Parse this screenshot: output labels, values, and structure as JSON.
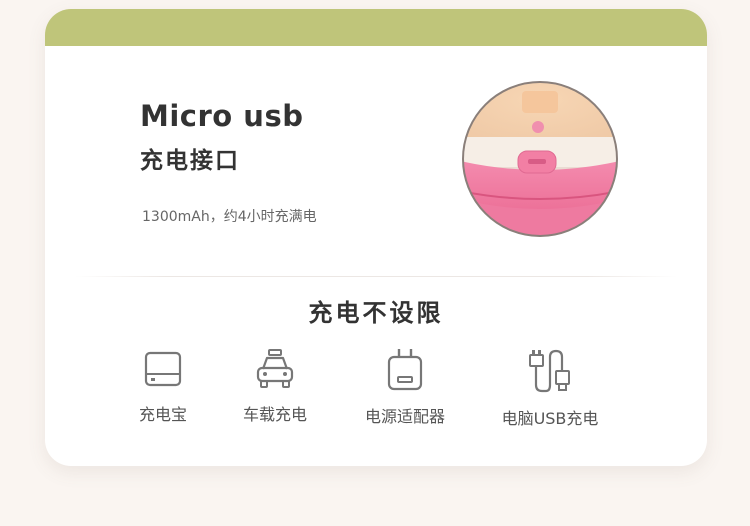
{
  "feature": {
    "title_en": "Micro usb",
    "title_cn": "充电接口",
    "description": "1300mAh，约4小时充满电",
    "product_image": "pink-humidifier-micro-usb-port"
  },
  "charging": {
    "section_title": "充电不设限",
    "options": [
      {
        "label": "充电宝",
        "icon": "power-bank-icon"
      },
      {
        "label": "车载充电",
        "icon": "car-icon"
      },
      {
        "label": "电源适配器",
        "icon": "power-adapter-icon"
      },
      {
        "label": "电脑USB充电",
        "icon": "usb-cable-icon"
      }
    ]
  },
  "colors": {
    "top_bar": "#bfc57a",
    "product_pink": "#f07aa0",
    "text_dark": "#333333",
    "icon_gray": "#777777"
  }
}
